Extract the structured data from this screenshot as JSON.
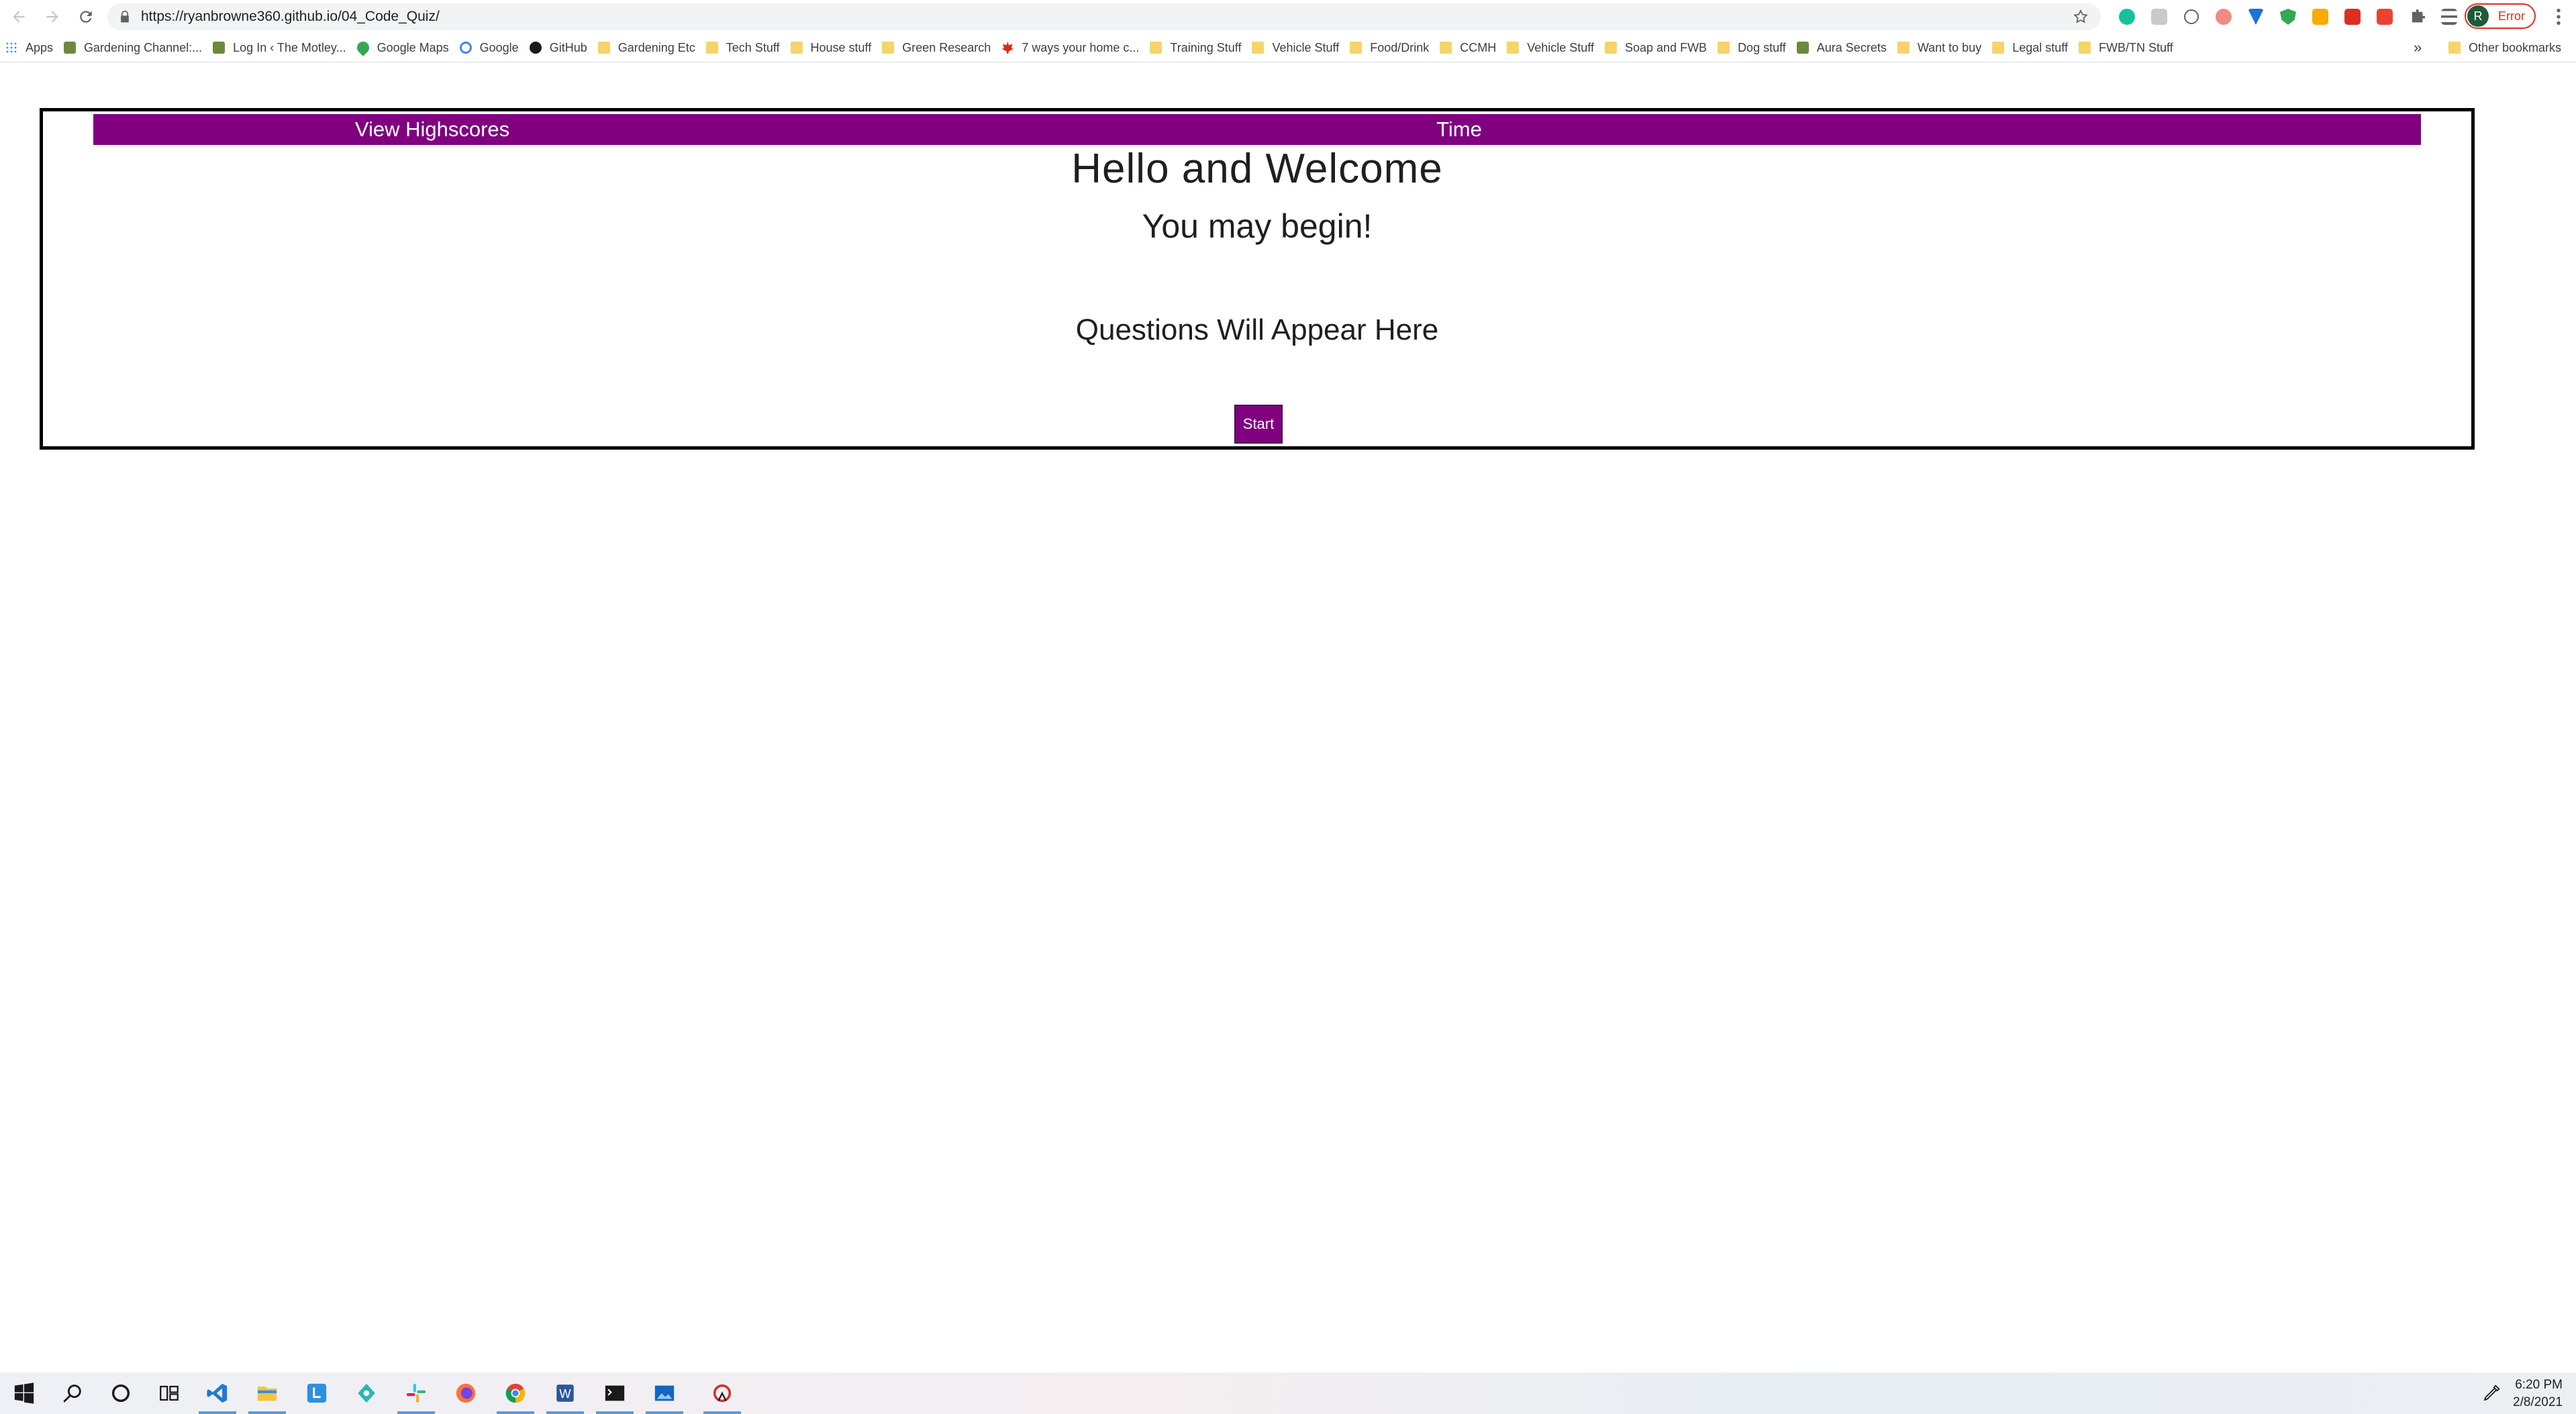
{
  "browser": {
    "url": "https://ryanbrowne360.github.io/04_Code_Quiz/",
    "profile_initial": "R",
    "profile_status": "Error",
    "bookmarks_overflow": "»",
    "bookmarks": [
      {
        "label": "Apps",
        "icon": "apps-grid-icon"
      },
      {
        "label": "Gardening Channel:...",
        "icon": "site-icon"
      },
      {
        "label": "Log In ‹ The Motley...",
        "icon": "site-icon"
      },
      {
        "label": "Google Maps",
        "icon": "maps-pin-icon"
      },
      {
        "label": "Google",
        "icon": "google-icon"
      },
      {
        "label": "GitHub",
        "icon": "github-icon"
      },
      {
        "label": "Gardening Etc",
        "icon": "folder-icon"
      },
      {
        "label": "Tech Stuff",
        "icon": "folder-icon"
      },
      {
        "label": "House stuff",
        "icon": "folder-icon"
      },
      {
        "label": "Green Research",
        "icon": "folder-icon"
      },
      {
        "label": "7 ways your home c...",
        "icon": "maple-leaf-icon"
      },
      {
        "label": "Training Stuff",
        "icon": "folder-icon"
      },
      {
        "label": "Vehicle Stuff",
        "icon": "folder-icon"
      },
      {
        "label": "Food/Drink",
        "icon": "folder-icon"
      },
      {
        "label": "CCMH",
        "icon": "folder-icon"
      },
      {
        "label": "Vehicle Stuff",
        "icon": "folder-icon"
      },
      {
        "label": "Soap and FWB",
        "icon": "folder-icon"
      },
      {
        "label": "Dog stuff",
        "icon": "folder-icon"
      },
      {
        "label": "Aura Secrets",
        "icon": "site-icon"
      },
      {
        "label": "Want to buy",
        "icon": "folder-icon"
      },
      {
        "label": "Legal stuff",
        "icon": "folder-icon"
      },
      {
        "label": "FWB/TN Stuff",
        "icon": "folder-icon"
      }
    ],
    "other_bookmarks": "Other bookmarks"
  },
  "quiz": {
    "header": {
      "highscores_label": "View Highscores",
      "time_label": "Time"
    },
    "welcome": "Hello and Welcome",
    "subheading": "You may begin!",
    "question": "Questions Will Appear Here",
    "start_label": "Start"
  },
  "colors": {
    "accent": "#800080",
    "border": "#000000",
    "profile_error": "#d93025"
  },
  "taskbar": {
    "time": "6:20 PM",
    "date": "2/8/2021",
    "apps": [
      "windows-start-icon",
      "search-icon",
      "cortana-icon",
      "task-view-icon",
      "vscode-icon",
      "file-explorer-icon",
      "l-app-icon",
      "gitkraken-icon",
      "slack-icon",
      "firefox-icon",
      "chrome-icon",
      "word-icon",
      "terminal-icon",
      "photos-icon",
      "screen-capture-icon"
    ]
  }
}
